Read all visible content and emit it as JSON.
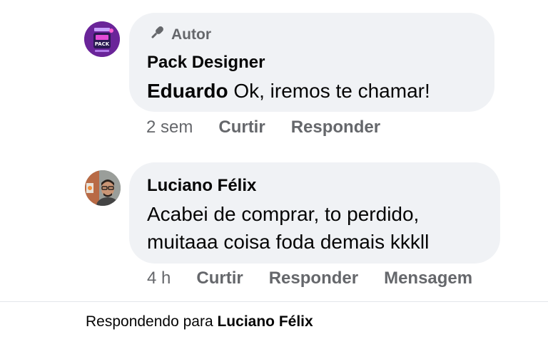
{
  "comments": [
    {
      "avatar": "pack-designer-logo",
      "badge_icon": "microphone-icon",
      "badge": "Autor",
      "author": "Pack Designer",
      "mention": "Eduardo",
      "text": " Ok, iremos te chamar!",
      "time": "2 sem",
      "like": "Curtir",
      "reply": "Responder"
    },
    {
      "avatar": "luciano-felix-photo",
      "author": "Luciano Félix",
      "text_line1": "Acabei de comprar, to perdido,",
      "text_line2": "muitaaa coisa foda demais kkkll",
      "time": "4 h",
      "like": "Curtir",
      "reply": "Responder",
      "message": "Mensagem"
    }
  ],
  "reply_bar": {
    "prefix": "Respondendo para ",
    "name": "Luciano Félix"
  },
  "colors": {
    "bubble": "#f0f2f5",
    "secondary_text": "#65676b",
    "primary_text": "#050505",
    "divider": "#e4e6eb"
  }
}
